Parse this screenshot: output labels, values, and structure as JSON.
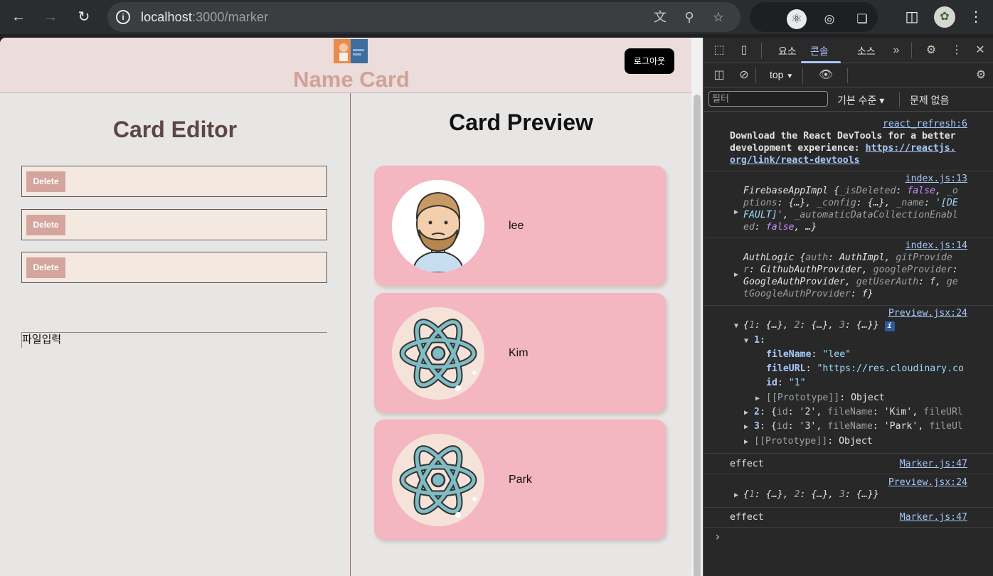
{
  "browser": {
    "url_host": "localhost",
    "url_path": ":3000/marker"
  },
  "app": {
    "brand": "Name Card",
    "logout_label": "로그아웃",
    "editor": {
      "title": "Card Editor",
      "delete_label": "Delete",
      "file_input_label": "파일입력"
    },
    "preview": {
      "title": "Card Preview",
      "cards": [
        {
          "name": "lee"
        },
        {
          "name": "Kim"
        },
        {
          "name": "Park"
        }
      ]
    }
  },
  "devtools": {
    "tabs": [
      "요소",
      "콘솔",
      "소스"
    ],
    "active_tab": "콘솔",
    "context": "top",
    "filter_placeholder": "필터",
    "levels_label": "기본 수준 ▾",
    "issues_label": "문제 없음",
    "messages": {
      "m1_src": "react_refresh:6",
      "m1_text_a": "Download the React DevTools for a better",
      "m1_text_b": "development experience: ",
      "m1_link_a": "https://reactjs.",
      "m1_link_b": "org/link/react-devtools",
      "m2_src": "index.js:13",
      "m3_src": "index.js:14",
      "m4_src": "Preview.jsx:24",
      "m5_text": "effect",
      "m5_src": "Marker.js:47",
      "m6_src": "Preview.jsx:24",
      "m7_text": "effect",
      "m7_src": "Marker.js:47"
    }
  }
}
